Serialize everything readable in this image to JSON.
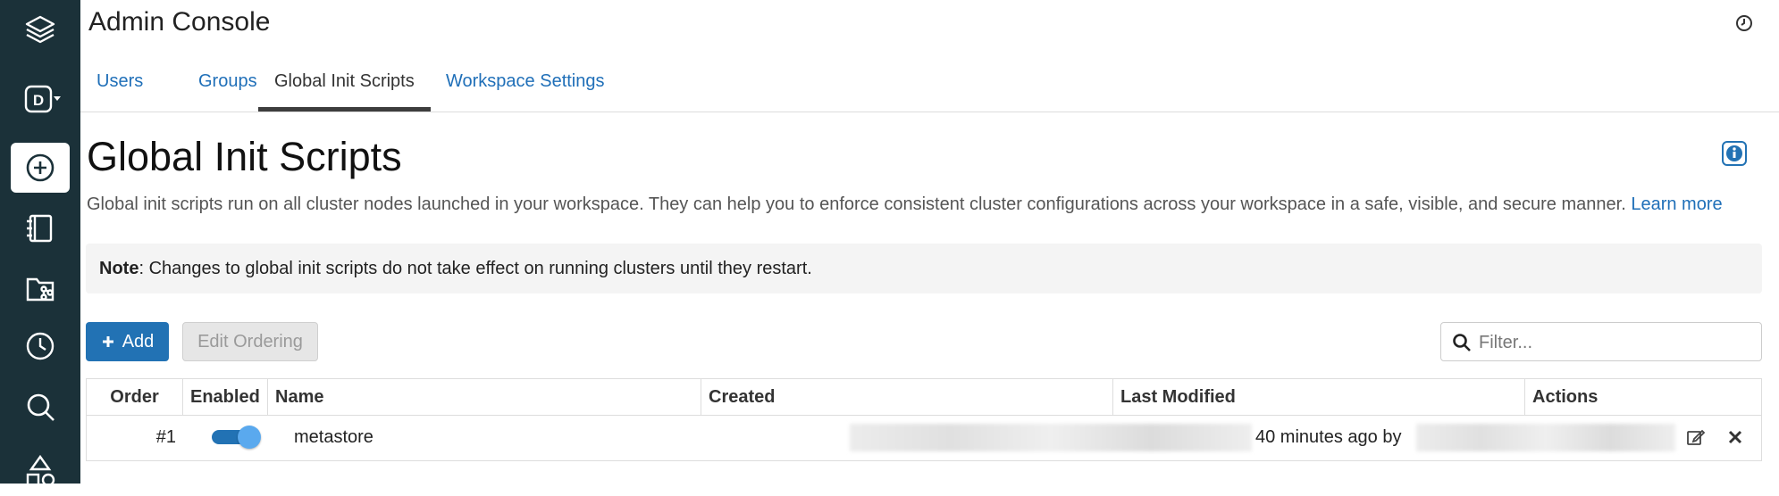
{
  "app": {
    "title": "Admin Console"
  },
  "tabs": [
    {
      "label": "Users",
      "active": false
    },
    {
      "label": "Groups",
      "active": false
    },
    {
      "label": "Global Init Scripts",
      "active": true
    },
    {
      "label": "Workspace Settings",
      "active": false
    }
  ],
  "page": {
    "title": "Global Init Scripts",
    "description": "Global init scripts run on all cluster nodes launched in your workspace. They can help you to enforce consistent cluster configurations across your workspace in a safe, visible, and secure manner.",
    "learn_more": "Learn more",
    "note_label": "Note",
    "note_text": ": Changes to global init scripts do not take effect on running clusters until they restart."
  },
  "toolbar": {
    "add_label": "Add",
    "edit_ordering_label": "Edit Ordering",
    "filter_placeholder": "Filter..."
  },
  "table": {
    "columns": {
      "order": "Order",
      "enabled": "Enabled",
      "name": "Name",
      "created": "Created",
      "last_modified": "Last Modified",
      "actions": "Actions"
    },
    "rows": [
      {
        "order": "#1",
        "enabled": true,
        "name": "metastore",
        "last_modified_prefix": "40 minutes ago by"
      }
    ]
  },
  "icons": {
    "sidebar": [
      "layers-icon",
      "workspace-d-icon",
      "create-plus-icon",
      "notebook-icon",
      "repos-icon",
      "history-clock-icon",
      "search-icon",
      "shapes-icon"
    ],
    "history": "history-icon",
    "info": "info-icon",
    "edit": "edit-icon",
    "delete": "delete-icon"
  },
  "colors": {
    "sidebar_bg": "#1b3139",
    "accent": "#2272b4",
    "link": "#1f6fb8"
  }
}
